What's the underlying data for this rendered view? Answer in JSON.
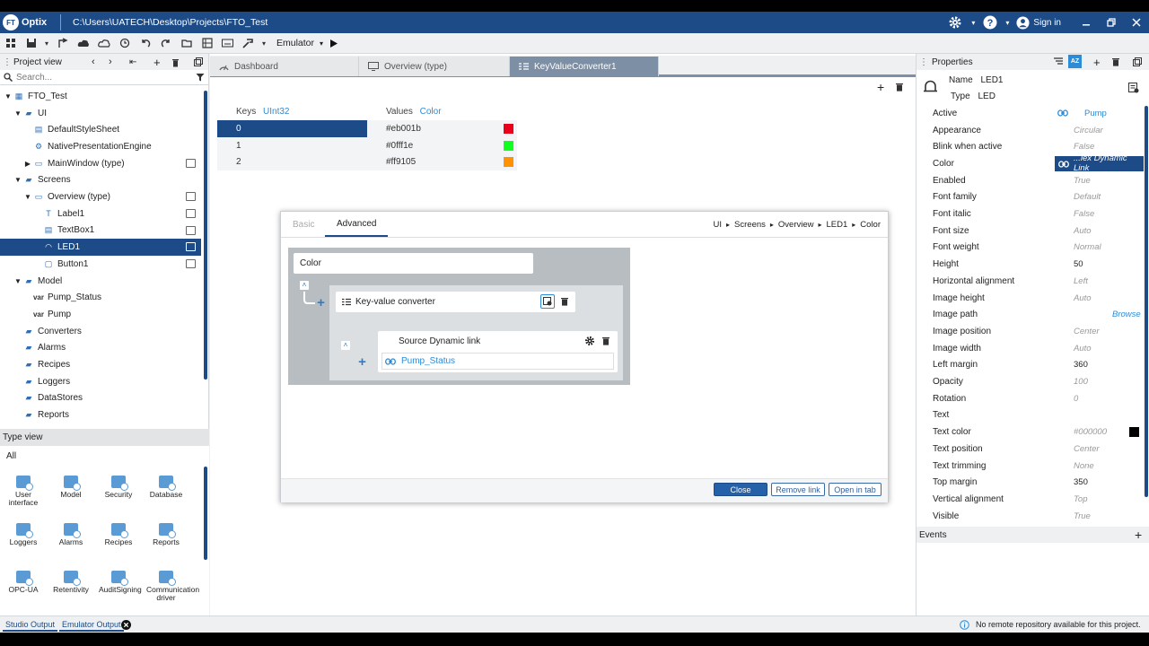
{
  "app": {
    "name": "Optix",
    "logo_text": "FT",
    "project_path": "C:\\Users\\UATECH\\Desktop\\Projects\\FTO_Test",
    "sign_in": "Sign in"
  },
  "toolbar": {
    "emulator_label": "Emulator"
  },
  "project_view": {
    "title": "Project view",
    "search_placeholder": "Search...",
    "items": [
      {
        "label": "FTO_Test",
        "icon": "project-icon"
      },
      {
        "label": "UI",
        "icon": "folder-icon"
      },
      {
        "label": "DefaultStyleSheet",
        "icon": "stylesheet-icon"
      },
      {
        "label": "NativePresentationEngine",
        "icon": "gear-icon"
      },
      {
        "label": "MainWindow (type)",
        "icon": "window-icon"
      },
      {
        "label": "Screens",
        "icon": "folder-icon"
      },
      {
        "label": "Overview (type)",
        "icon": "screen-icon"
      },
      {
        "label": "Label1",
        "icon": "label-icon"
      },
      {
        "label": "TextBox1",
        "icon": "textbox-icon"
      },
      {
        "label": "LED1",
        "icon": "led-icon"
      },
      {
        "label": "Button1",
        "icon": "button-icon"
      },
      {
        "label": "Model",
        "icon": "folder-icon"
      },
      {
        "label": "Pump_Status",
        "icon": "var-icon"
      },
      {
        "label": "Pump",
        "icon": "var-icon"
      },
      {
        "label": "Converters",
        "icon": "folder-icon"
      },
      {
        "label": "Alarms",
        "icon": "folder-icon"
      },
      {
        "label": "Recipes",
        "icon": "folder-icon"
      },
      {
        "label": "Loggers",
        "icon": "folder-icon"
      },
      {
        "label": "DataStores",
        "icon": "folder-icon"
      },
      {
        "label": "Reports",
        "icon": "folder-icon"
      }
    ],
    "var_prefix": "var"
  },
  "type_view": {
    "title": "Type view",
    "filter": "All",
    "items": [
      "User interface",
      "Model",
      "Security",
      "Database",
      "Loggers",
      "Alarms",
      "Recipes",
      "Reports",
      "OPC-UA",
      "Retentivity",
      "AuditSigning",
      "Communication driver"
    ]
  },
  "editor_tabs": [
    {
      "label": "Dashboard",
      "icon": "dashboard-icon"
    },
    {
      "label": "Overview (type)",
      "icon": "screen-icon"
    },
    {
      "label": "KeyValueConverter1",
      "icon": "converter-icon"
    }
  ],
  "kv_table": {
    "keys_label": "Keys",
    "keys_type": "UInt32",
    "values_label": "Values",
    "values_type": "Color",
    "rows": [
      {
        "key": "0",
        "value": "#eb001b",
        "color": "#eb001b"
      },
      {
        "key": "1",
        "value": "#0fff1e",
        "color": "#0fff1e"
      },
      {
        "key": "2",
        "value": "#ff9105",
        "color": "#ff9105"
      }
    ]
  },
  "dialog": {
    "tab_basic": "Basic",
    "tab_advanced": "Advanced",
    "breadcrumb": [
      "UI",
      "Screens",
      "Overview",
      "LED1",
      "Color"
    ],
    "color_node": "Color",
    "converter_node": "Key-value converter",
    "source_node": "Source Dynamic link",
    "source_value": "Pump_Status",
    "close": "Close",
    "remove_link": "Remove link",
    "open_in_tab": "Open in tab"
  },
  "properties": {
    "title": "Properties",
    "name_label": "Name",
    "name_value": "LED1",
    "type_label": "Type",
    "type_value": "LED",
    "rows": [
      {
        "name": "Active",
        "value": "Pump",
        "kind": "link"
      },
      {
        "name": "Appearance",
        "value": "Circular",
        "kind": "default"
      },
      {
        "name": "Blink when active",
        "value": "False",
        "kind": "default"
      },
      {
        "name": "Color",
        "value": "...lex Dynamic Link",
        "kind": "selected"
      },
      {
        "name": "Enabled",
        "value": "True",
        "kind": "default"
      },
      {
        "name": "Font family",
        "value": "Default",
        "kind": "default"
      },
      {
        "name": "Font italic",
        "value": "False",
        "kind": "default"
      },
      {
        "name": "Font size",
        "value": "Auto",
        "kind": "default"
      },
      {
        "name": "Font weight",
        "value": "Normal",
        "kind": "default"
      },
      {
        "name": "Height",
        "value": "50",
        "kind": "plain"
      },
      {
        "name": "Horizontal alignment",
        "value": "Left",
        "kind": "default"
      },
      {
        "name": "Image height",
        "value": "Auto",
        "kind": "default"
      },
      {
        "name": "Image path",
        "value": "Browse",
        "kind": "browse"
      },
      {
        "name": "Image position",
        "value": "Center",
        "kind": "default"
      },
      {
        "name": "Image width",
        "value": "Auto",
        "kind": "default"
      },
      {
        "name": "Left margin",
        "value": "360",
        "kind": "plain"
      },
      {
        "name": "Opacity",
        "value": "100",
        "kind": "default"
      },
      {
        "name": "Rotation",
        "value": "0",
        "kind": "default"
      },
      {
        "name": "Text",
        "value": "",
        "kind": "plain"
      },
      {
        "name": "Text color",
        "value": "#000000",
        "kind": "color"
      },
      {
        "name": "Text position",
        "value": "Center",
        "kind": "default"
      },
      {
        "name": "Text trimming",
        "value": "None",
        "kind": "default"
      },
      {
        "name": "Top margin",
        "value": "350",
        "kind": "plain"
      },
      {
        "name": "Vertical alignment",
        "value": "Top",
        "kind": "default"
      },
      {
        "name": "Visible",
        "value": "True",
        "kind": "default"
      }
    ],
    "events_label": "Events"
  },
  "status": {
    "tab_studio": "Studio Output",
    "tab_emulator": "Emulator Output",
    "message": "No remote repository available for this project."
  },
  "colors": {
    "brand": "#1c4b88",
    "accent": "#2e8bd6"
  }
}
